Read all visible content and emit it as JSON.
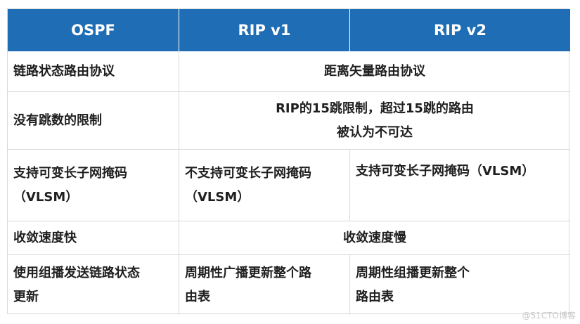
{
  "headers": [
    "OSPF",
    "RIP v1",
    "RIP v2"
  ],
  "rows": [
    {
      "ospf": [
        "链路状态路由协议"
      ],
      "rip": [
        "距离矢量路由协议"
      ]
    },
    {
      "ospf": [
        "没有跳数的限制"
      ],
      "rip": [
        "RIP的15跳限制，超过15跳的路由",
        "被认为不可达"
      ]
    },
    {
      "ospf": [
        "支持可变长子网掩码",
        "（VLSM）"
      ],
      "rip_v1": [
        "不支持可变长子网掩码",
        "（VLSM）"
      ],
      "rip_v2": [
        "支持可变长子网掩码（VLSM）"
      ]
    },
    {
      "ospf": [
        "收敛速度快"
      ],
      "rip": [
        "收敛速度慢"
      ]
    },
    {
      "ospf": [
        "使用组播发送链路状态",
        "更新"
      ],
      "rip_v1": [
        "周期性广播更新整个路",
        "由表"
      ],
      "rip_v2": [
        "周期性组播更新整个",
        "路由表"
      ]
    }
  ],
  "watermark": "@51CTO博客",
  "colors": {
    "header_bg": "#1f6eb5",
    "header_text": "#ffffff",
    "border": "#d9d9d9"
  }
}
